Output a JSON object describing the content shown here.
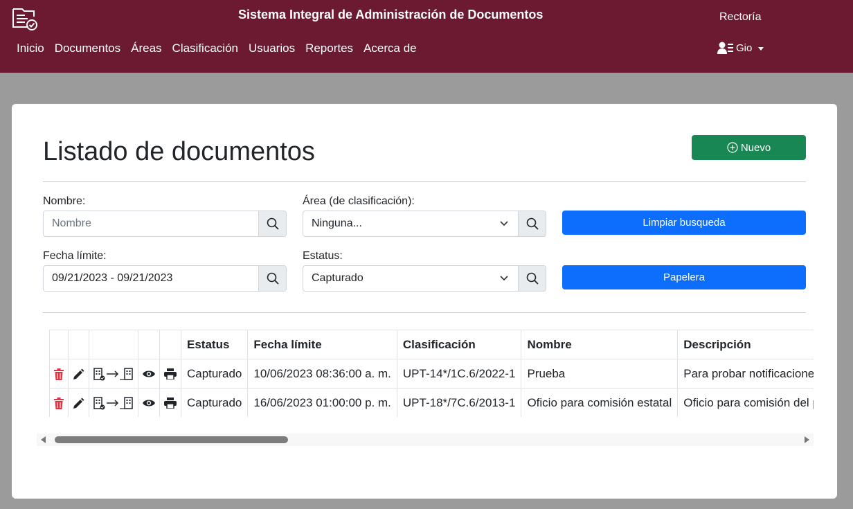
{
  "header": {
    "app_title": "Sistema Integral de Administración de Documentos",
    "org_label": "Rectoría",
    "user_name": "Gio",
    "nav": [
      "Inicio",
      "Documentos",
      "Áreas",
      "Clasificación",
      "Usuarios",
      "Reportes",
      "Acerca de"
    ]
  },
  "page": {
    "title": "Listado de documentos",
    "new_button": "Nuevo"
  },
  "filters": {
    "nombre_label": "Nombre:",
    "nombre_placeholder": "Nombre",
    "area_label": "Área (de clasificación):",
    "area_value": "Ninguna...",
    "fecha_label": "Fecha límite:",
    "fecha_value": "09/21/2023 - 09/21/2023",
    "estatus_label": "Estatus:",
    "estatus_value": "Capturado",
    "clear_button": "Limpiar busqueda",
    "trash_button": "Papelera"
  },
  "table": {
    "columns": [
      "Estatus",
      "Fecha límite",
      "Clasificación",
      "Nombre",
      "Descripción"
    ],
    "rows": [
      [
        "Capturado",
        "10/06/2023 08:36:00 a. m.",
        "UPT-14*/1C.6/2022-1",
        "Prueba",
        "Para probar notificaciones"
      ],
      [
        "Capturado",
        "16/06/2023 01:00:00 p. m.",
        "UPT-18*/7C.6/2013-1",
        "Oficio para comisión estatal",
        "Oficio para comisión del personal"
      ]
    ]
  },
  "icons": {
    "row_actions": [
      "trash-icon",
      "pencil-icon",
      "transfer-icon",
      "eye-icon",
      "printer-icon"
    ],
    "search": "search-icon"
  },
  "colors": {
    "header_bg": "#6b1a32",
    "success": "#198754",
    "primary": "#0d6efd",
    "danger": "#dc3545"
  }
}
